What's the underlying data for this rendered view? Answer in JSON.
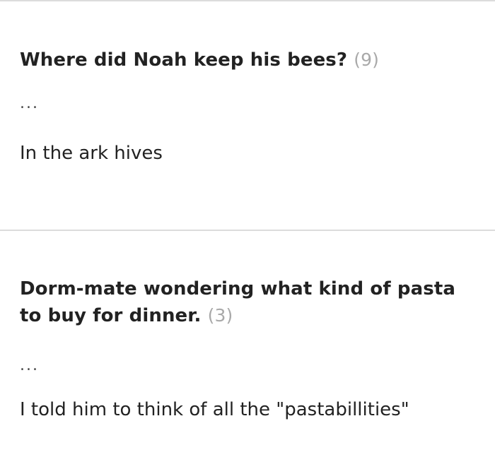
{
  "posts": [
    {
      "title": "Where did Noah keep his bees?",
      "count": "(9)",
      "ellipsis": "...",
      "punchline": "In the ark hives"
    },
    {
      "title": "Dorm-mate wondering what kind of pasta to buy for dinner.",
      "count": "(3)",
      "ellipsis": "...",
      "punchline": "I told him to think of all the \"pastabillities\""
    }
  ]
}
